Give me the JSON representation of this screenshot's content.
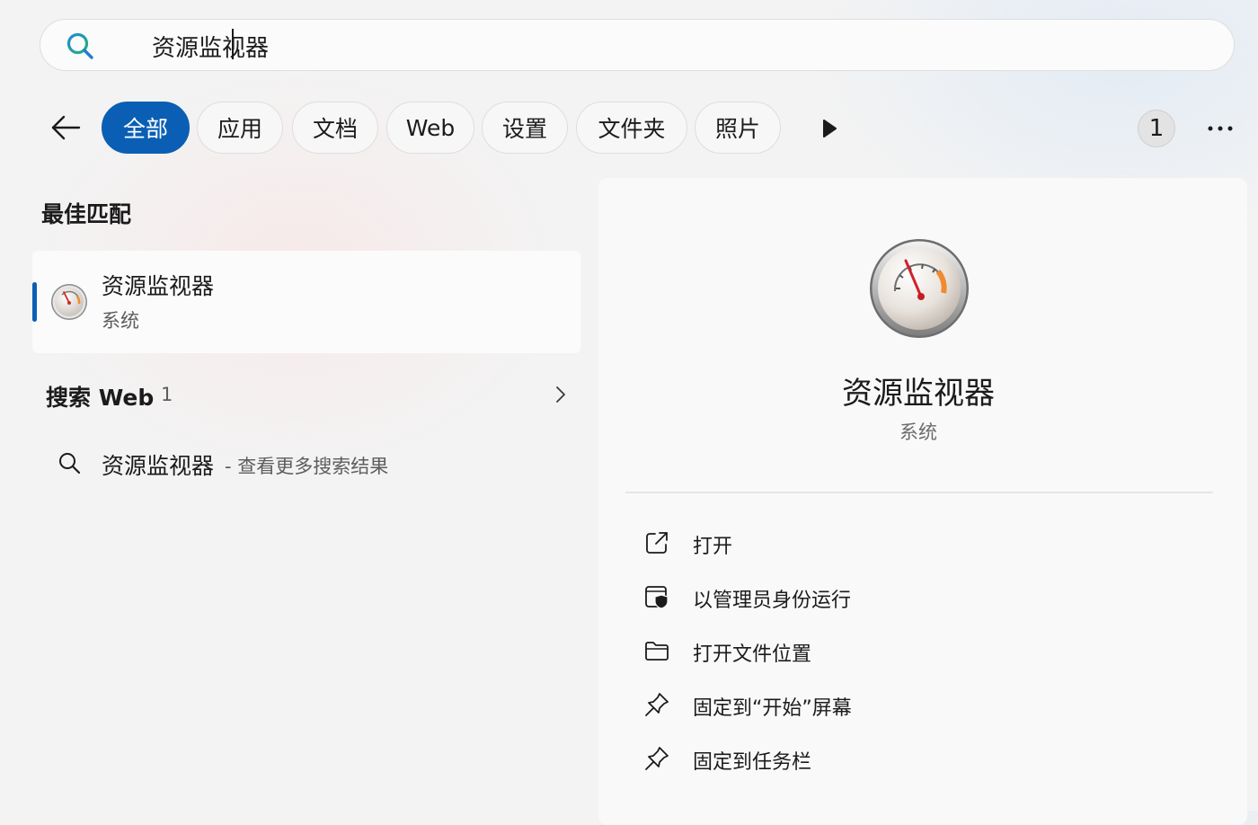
{
  "search": {
    "value": "资源监视器",
    "icon": "search-icon"
  },
  "filters": {
    "back_icon": "arrow-left-icon",
    "tabs": [
      {
        "label": "全部",
        "active": true
      },
      {
        "label": "应用",
        "active": false
      },
      {
        "label": "文档",
        "active": false
      },
      {
        "label": "Web",
        "active": false
      },
      {
        "label": "设置",
        "active": false
      },
      {
        "label": "文件夹",
        "active": false
      },
      {
        "label": "照片",
        "active": false
      }
    ],
    "more_tabs_icon": "play-right-icon",
    "rewards_count": "1",
    "more_options_icon": "ellipsis-icon"
  },
  "best_match": {
    "heading": "最佳匹配",
    "name": "资源监视器",
    "type": "系统"
  },
  "web": {
    "heading": "搜索 Web",
    "count": "1",
    "result_query": "资源监视器",
    "result_suffix": "- 查看更多搜索结果"
  },
  "preview": {
    "title": "资源监视器",
    "subtitle": "系统",
    "actions": [
      {
        "label": "打开",
        "icon": "open-external-icon"
      },
      {
        "label": "以管理员身份运行",
        "icon": "admin-shield-icon"
      },
      {
        "label": "打开文件位置",
        "icon": "folder-icon"
      },
      {
        "label": "固定到“开始”屏幕",
        "icon": "pin-icon"
      },
      {
        "label": "固定到任务栏",
        "icon": "pin-icon"
      }
    ]
  },
  "colors": {
    "accent": "#0a5fb4",
    "background": "#f3f3f3",
    "panel": "#f9f9f9"
  }
}
